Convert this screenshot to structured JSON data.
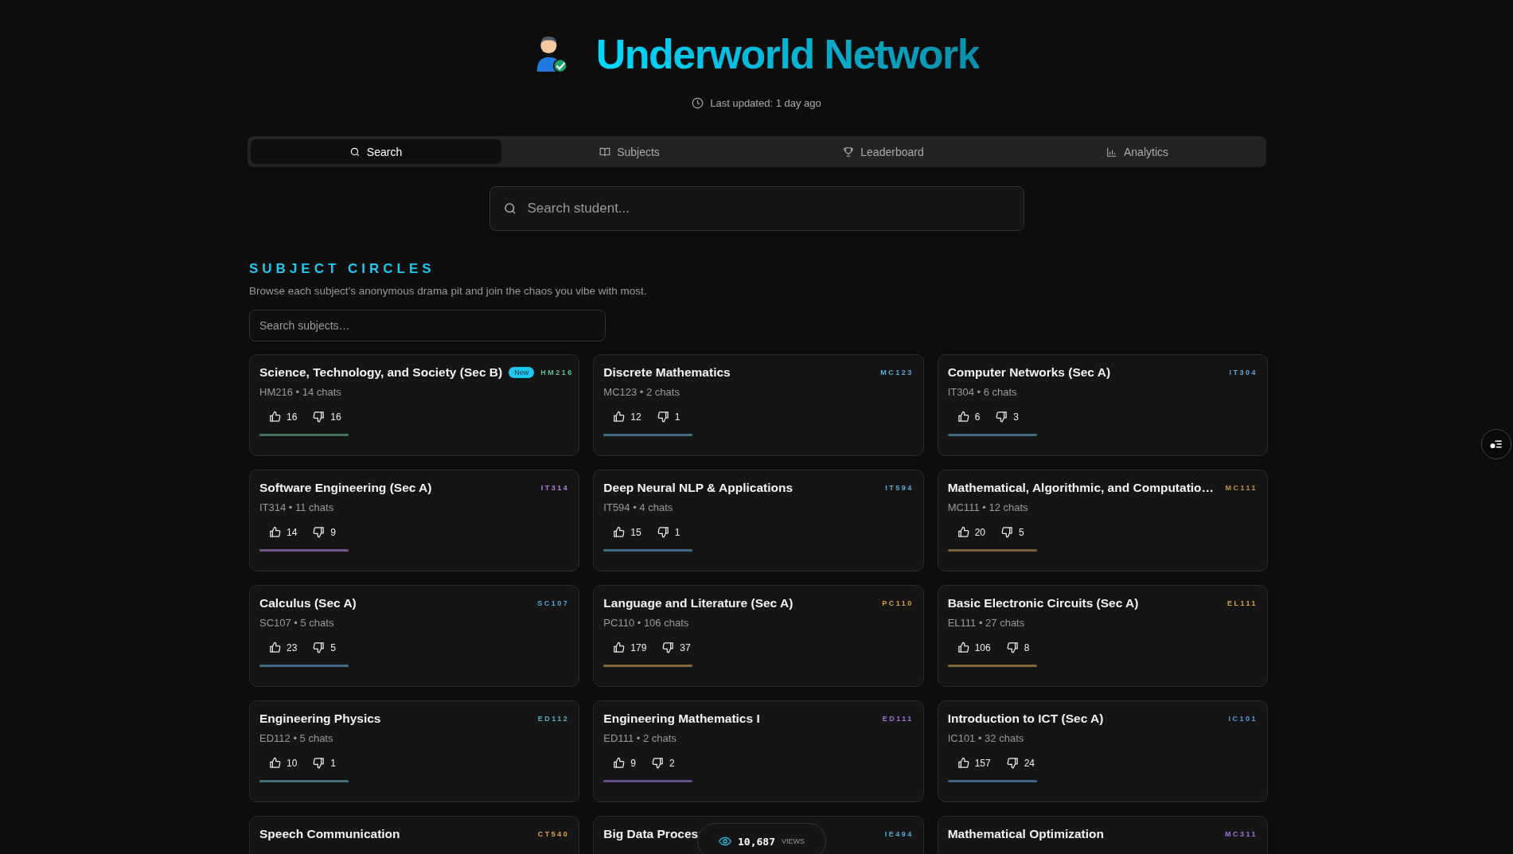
{
  "header": {
    "title": "Underworld Network",
    "updated": "Last updated: 1 day ago"
  },
  "tabs": [
    {
      "label": "Search",
      "selected": true
    },
    {
      "label": "Subjects",
      "selected": false
    },
    {
      "label": "Leaderboard",
      "selected": false
    },
    {
      "label": "Analytics",
      "selected": false
    }
  ],
  "student_search": {
    "placeholder": "Search student..."
  },
  "section": {
    "title": "SUBJECT CIRCLES",
    "subtitle": "Browse each subject’s anonymous drama pit and join the chaos you vibe with most."
  },
  "subject_search": {
    "placeholder": "Search subjects…"
  },
  "cards": [
    {
      "title": "Science, Technology, and Society (Sec B)",
      "badge": "New",
      "code": "HM216",
      "color": "#5fbf8f",
      "meta": "HM216 • 14 chats",
      "likes": "16",
      "dislikes": "16"
    },
    {
      "title": "Discrete Mathematics",
      "code": "MC123",
      "color": "#5aa8d8",
      "meta": "MC123 • 2 chats",
      "likes": "12",
      "dislikes": "1"
    },
    {
      "title": "Computer Networks (Sec A)",
      "code": "IT304",
      "color": "#5aa8d8",
      "meta": "IT304 • 6 chats",
      "likes": "6",
      "dislikes": "3"
    },
    {
      "title": "Software Engineering (Sec A)",
      "code": "IT314",
      "color": "#b07ce0",
      "meta": "IT314 • 11 chats",
      "likes": "14",
      "dislikes": "9"
    },
    {
      "title": "Deep Neural NLP & Applications",
      "code": "IT594",
      "color": "#5aa8d8",
      "meta": "IT594 • 4 chats",
      "likes": "15",
      "dislikes": "1"
    },
    {
      "title": "Mathematical, Algorithmic, and Computatio…",
      "code": "MC111",
      "color": "#c09050",
      "meta": "MC111 • 12 chats",
      "likes": "20",
      "dislikes": "5"
    },
    {
      "title": "Calculus (Sec A)",
      "code": "SC107",
      "color": "#5aa8d8",
      "meta": "SC107 • 5 chats",
      "likes": "23",
      "dislikes": "5"
    },
    {
      "title": "Language and Literature (Sec A)",
      "code": "PC110",
      "color": "#d8a048",
      "meta": "PC110 • 106 chats",
      "likes": "179",
      "dislikes": "37"
    },
    {
      "title": "Basic Electronic Circuits (Sec A)",
      "code": "EL111",
      "color": "#d8a048",
      "meta": "EL111 • 27 chats",
      "likes": "106",
      "dislikes": "8"
    },
    {
      "title": "Engineering Physics",
      "code": "ED112",
      "color": "#5ab0c0",
      "meta": "ED112 • 5 chats",
      "likes": "10",
      "dislikes": "1"
    },
    {
      "title": "Engineering Mathematics I",
      "code": "ED111",
      "color": "#a070e0",
      "meta": "ED111 • 2 chats",
      "likes": "9",
      "dislikes": "2"
    },
    {
      "title": "Introduction to ICT (Sec A)",
      "code": "IC101",
      "color": "#5a9ae0",
      "meta": "IC101 • 32 chats",
      "likes": "157",
      "dislikes": "24"
    },
    {
      "title": "Speech Communication",
      "code": "CT540",
      "color": "#e0a050"
    },
    {
      "title": "Big Data Proces",
      "code": "IE494",
      "color": "#5aa8d8"
    },
    {
      "title": "Mathematical Optimization",
      "code": "MC311",
      "color": "#a070e0"
    }
  ],
  "views": {
    "count": "10,687",
    "label": "VIEWS"
  }
}
